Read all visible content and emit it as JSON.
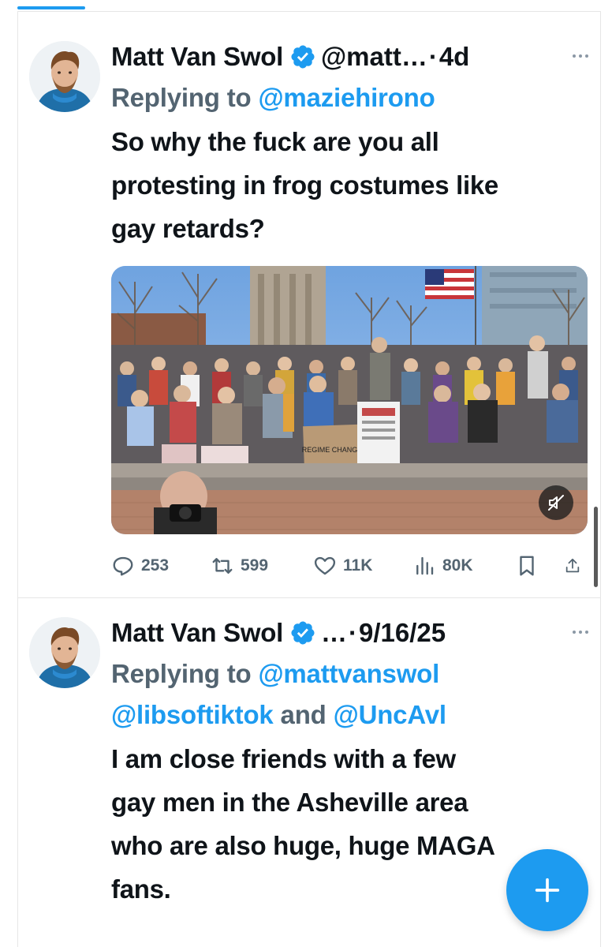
{
  "tweets": [
    {
      "name": "Matt Van Swol",
      "handle": "@matt…",
      "separator": "·",
      "time": "4d",
      "reply_prefix": "Replying to ",
      "reply_mentions": "@maziehirono",
      "reply_mentions_2": "",
      "text_lines": [
        "So why the fuck are you all",
        "protesting in frog costumes like",
        "gay retards?"
      ],
      "media": {
        "type": "video",
        "sign_text": "REGIME CHANGE",
        "muted_icon": "speaker-muted-icon"
      },
      "stats": {
        "replies": "253",
        "retweets": "599",
        "likes": "11K",
        "views": "80K"
      }
    },
    {
      "name": "Matt Van Swol",
      "handle": "…",
      "separator": "·",
      "time": "9/16/25",
      "reply_prefix": "Replying to ",
      "reply_mentions": "@mattvanswol",
      "reply_mentions_2_a": "@libsoftiktok",
      "reply_and": " and ",
      "reply_mentions_2_b": "@UncAvl",
      "text_lines": [
        "I am close friends with a few",
        "gay men in the Asheville area",
        "who are also huge, huge MAGA",
        "fans."
      ]
    }
  ],
  "fab": {
    "icon": "plus-icon"
  },
  "colors": {
    "accent": "#1d9bf0",
    "text": "#0f1419",
    "secondary": "#536471",
    "border": "#e6e6e6"
  }
}
